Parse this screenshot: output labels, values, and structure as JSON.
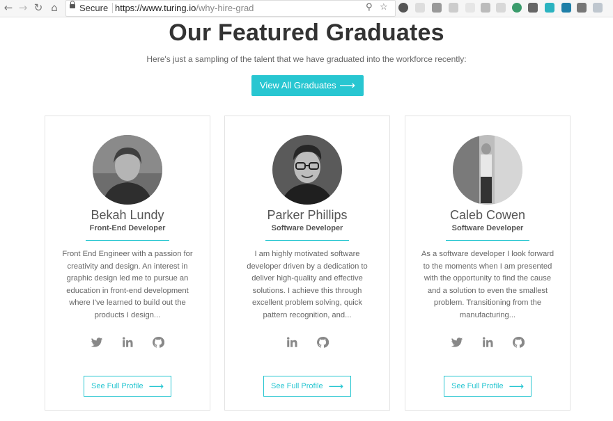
{
  "browser": {
    "secure_label": "Secure",
    "url_domain": "https://www.turing.io",
    "url_path": "/why-hire-grad"
  },
  "page": {
    "title": "Our Featured Graduates",
    "subtitle": "Here's just a sampling of the talent that we have graduated into the workforce recently:",
    "view_all_label": "View All Graduates"
  },
  "accent_color": "#28c6d1",
  "graduates": [
    {
      "name": "Bekah Lundy",
      "role": "Front-End Developer",
      "bio": "Front End Engineer with a passion for creativity and design. An interest in graphic design led me to pursue an education in front-end development where I've learned to build out the products I design...",
      "socials": [
        "twitter-icon",
        "linkedin-icon",
        "github-icon"
      ],
      "profile_label": "See Full Profile"
    },
    {
      "name": "Parker Phillips",
      "role": "Software Developer",
      "bio": "I am highly motivated software developer driven by a dedication to deliver high-quality and effective solutions. I achieve this through excellent problem solving, quick pattern recognition, and...",
      "socials": [
        "linkedin-icon",
        "github-icon"
      ],
      "profile_label": "See Full Profile"
    },
    {
      "name": "Caleb Cowen",
      "role": "Software Developer",
      "bio": "As a software developer I look forward to the moments when I am presented with the opportunity to find the cause and a solution to even the smallest problem. Transitioning from the manufacturing...",
      "socials": [
        "twitter-icon",
        "linkedin-icon",
        "github-icon"
      ],
      "profile_label": "See Full Profile"
    }
  ]
}
